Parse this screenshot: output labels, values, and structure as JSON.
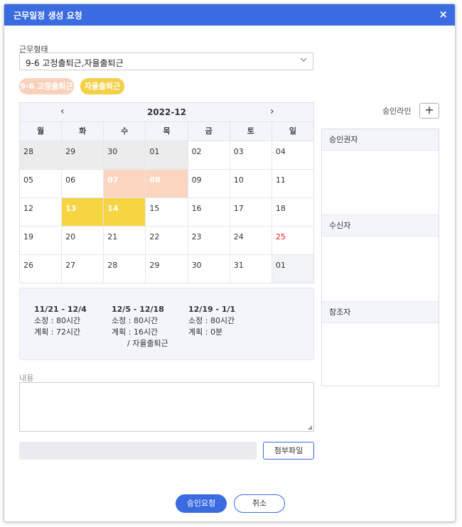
{
  "dialog": {
    "title": "근무일정 생성 요청",
    "close_icon": "×"
  },
  "work_type": {
    "label": "근무형태",
    "value": "9-6 고정출퇴근,자율출퇴근"
  },
  "chips": [
    "9-6 고정출퇴근",
    "자율출퇴근"
  ],
  "calendar": {
    "month": "2022-12",
    "prev": "‹",
    "next": "›",
    "weekdays": [
      "월",
      "화",
      "수",
      "목",
      "금",
      "토",
      "일"
    ],
    "weeks": [
      [
        "28",
        "29",
        "30",
        "01",
        "02",
        "03",
        "04"
      ],
      [
        "05",
        "06",
        "07",
        "08",
        "09",
        "10",
        "11"
      ],
      [
        "12",
        "13",
        "14",
        "15",
        "16",
        "17",
        "18"
      ],
      [
        "19",
        "20",
        "21",
        "22",
        "23",
        "24",
        "25"
      ],
      [
        "26",
        "27",
        "28",
        "29",
        "30",
        "31",
        "01"
      ]
    ]
  },
  "summary": [
    {
      "range": "11/21 - 12/4",
      "std": "소정 : 80시간",
      "plan": "계획 : 72시간",
      "extra": ""
    },
    {
      "range": "12/5 - 12/18",
      "std": "소정 : 80시간",
      "plan": "계획 : 16시간",
      "extra": "/ 자율출퇴근"
    },
    {
      "range": "12/19 - 1/1",
      "std": "소정 : 80시간",
      "plan": "계획 : 0분",
      "extra": ""
    }
  ],
  "content": {
    "label": "내용",
    "value": ""
  },
  "attach_button": "첨부파일",
  "approval": {
    "label": "승인라인",
    "add": "+",
    "sections": [
      "승인권자",
      "수신자",
      "참조자"
    ]
  },
  "buttons": {
    "submit": "승인요청",
    "cancel": "취소"
  },
  "colors": {
    "primary": "#3a6be0",
    "peach": "#fcd5bf",
    "yellow": "#f6d442",
    "holiday": "#e02020"
  }
}
